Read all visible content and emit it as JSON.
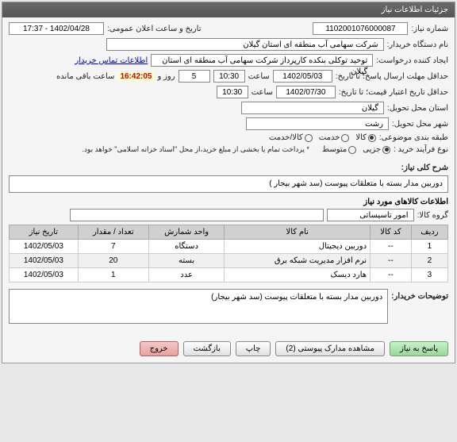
{
  "header": {
    "title": "جزئیات اطلاعات نیاز"
  },
  "labels": {
    "need_no": "شماره نیاز:",
    "announce": "تاریخ و ساعت اعلان عمومی:",
    "buyer_name": "نام دستگاه خریدار:",
    "request_creator": "ایجاد کننده درخواست:",
    "contact_info": "اطلاعات تماس خریدار",
    "deadline": "حداقل مهلت ارسال پاسخ؛ تا تاریخ:",
    "saat": "ساعت",
    "rooz_va": "روز و",
    "remaining": "ساعت باقی مانده",
    "credit_until": "حداقل تاریخ اعتبار قیمت؛ تا تاریخ:",
    "province": "استان محل تحویل:",
    "city": "شهر محل تحویل:",
    "category": "طبقه بندی موضوعی:",
    "purchase_type": "نوع فرآیند خرید :",
    "payment_note": "* پرداخت تمام یا بخشی از مبلغ خرید،از محل \"اسناد خزانه اسلامی\" خواهد بود.",
    "general_desc": "شرح کلی نیاز:",
    "items_title": "اطلاعات کالاهای مورد نیاز",
    "goods_group": "گروه کالا:",
    "buyer_notes": "توضیحات خریدار:"
  },
  "values": {
    "need_no": "1102001076000087",
    "announce": "1402/04/28 - 17:37",
    "buyer_name": "شرکت سهامی آب منطقه ای استان گیلان",
    "request_creator": "توحید توکلی بنکده کارپرداز شرکت سهامی آب منطقه ای استان گیلان",
    "deadline_date": "1402/05/03",
    "deadline_time": "10:30",
    "days_left": "5",
    "countdown": "16:42:05",
    "credit_date": "1402/07/30",
    "credit_time": "10:30",
    "province": "گیلان",
    "city": "رشت",
    "general_desc": "دوربین مدار بسته با متعلقات پیوست (سد شهر بیجار )",
    "goods_group": "امور تاسیساتی",
    "buyer_notes": "دوربین مدار بسته با متعلقات پیوست (سد شهر بیجار)"
  },
  "category_opts": {
    "kala": "کالا",
    "khadamat": "خدمت",
    "both": "کالا/خدمت"
  },
  "purchase_opts": {
    "jozi": "جزیی",
    "motevaset": "متوسط"
  },
  "table": {
    "headers": {
      "row": "ردیف",
      "code": "کد کالا",
      "name": "نام کالا",
      "unit": "واحد شمارش",
      "qty": "تعداد / مقدار",
      "date": "تاریخ نیاز"
    },
    "rows": [
      {
        "row": "1",
        "code": "--",
        "name": "دوربین دیجیتال",
        "unit": "دستگاه",
        "qty": "7",
        "date": "1402/05/03"
      },
      {
        "row": "2",
        "code": "--",
        "name": "نرم افزار مدیریت شبکه برق",
        "unit": "بسته",
        "qty": "20",
        "date": "1402/05/03"
      },
      {
        "row": "3",
        "code": "--",
        "name": "هارد دیسک",
        "unit": "عدد",
        "qty": "1",
        "date": "1402/05/03"
      }
    ]
  },
  "buttons": {
    "respond": "پاسخ به نیاز",
    "attachments": "مشاهده مدارک پیوستی (2)",
    "print": "چاپ",
    "back": "بازگشت",
    "exit": "خروج"
  }
}
